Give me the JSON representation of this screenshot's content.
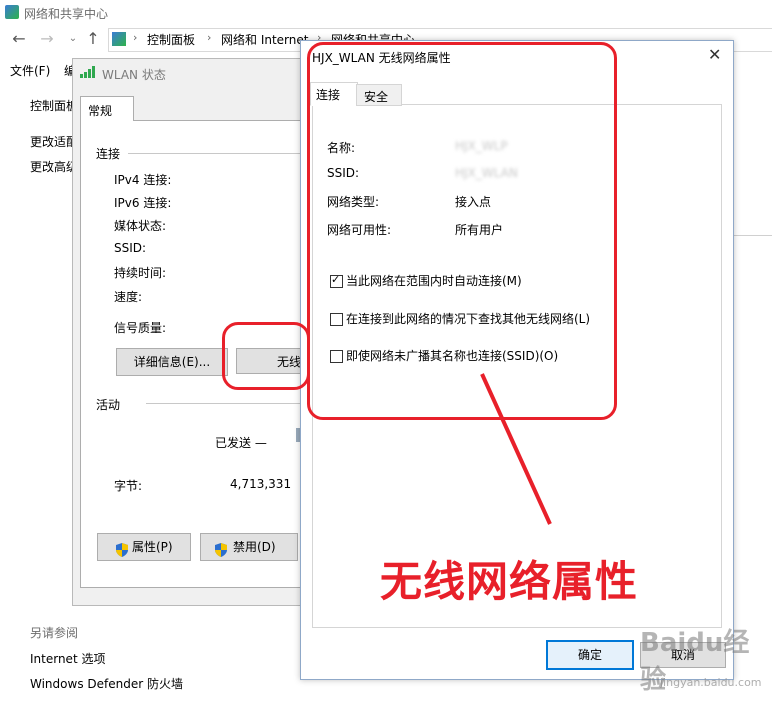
{
  "background_window": {
    "title": "网络和共享中心",
    "breadcrumbs": [
      "控制面板",
      "网络和 Internet",
      "网络和共享中心"
    ],
    "menu": [
      "文件(F)",
      "编"
    ],
    "sidebar_links": [
      "控制面板",
      "更改适配",
      "更改高级"
    ],
    "see_also_label": "另请参阅",
    "see_also_links": [
      "Internet 选项",
      "Windows Defender 防火墙"
    ]
  },
  "wlan_status": {
    "title": "WLAN 状态",
    "tab": "常规",
    "connection_group": "连接",
    "rows": [
      "IPv4 连接:",
      "IPv6 连接:",
      "媒体状态:",
      "SSID:",
      "持续时间:",
      "速度:"
    ],
    "signal_label": "信号质量:",
    "details_button": "详细信息(E)...",
    "wireless_button": "无线",
    "activity_group": "活动",
    "sent_label": "已发送 —",
    "bytes_label": "字节:",
    "bytes_value": "4,713,331",
    "properties_button": "属性(P)",
    "disable_button": "禁用(D)"
  },
  "wireless_properties": {
    "title": "HJX_WLAN 无线网络属性",
    "tabs": [
      "连接",
      "安全"
    ],
    "fields": [
      {
        "label": "名称:",
        "value": "HJX_WLP"
      },
      {
        "label": "SSID:",
        "value": "HJX_WLAN"
      },
      {
        "label": "网络类型:",
        "value": "接入点"
      },
      {
        "label": "网络可用性:",
        "value": "所有用户"
      }
    ],
    "checkboxes": [
      {
        "label": "当此网络在范围内时自动连接(M)",
        "checked": true
      },
      {
        "label": "在连接到此网络的情况下查找其他无线网络(L)",
        "checked": false
      },
      {
        "label": "即使网络未广播其名称也连接(SSID)(O)",
        "checked": false
      }
    ],
    "ok_button": "确定",
    "cancel_button": "取消"
  },
  "annotation": {
    "text": "无线网络属性",
    "color": "#e8202a"
  },
  "watermark": {
    "text": "Baidu经验",
    "url_text": "jingyan.baidu.com"
  },
  "colors": {
    "accent": "#0078d7",
    "annotation_red": "#e8202a"
  }
}
